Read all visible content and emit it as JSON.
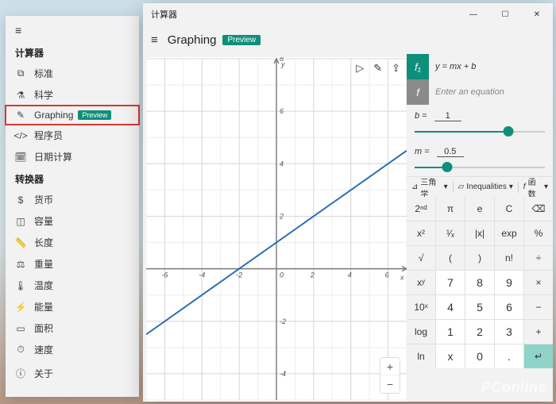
{
  "watermark": "PConline",
  "sidebar": {
    "sections": [
      {
        "header": "计算器",
        "items": [
          {
            "icon": "⧉",
            "label": "标准"
          },
          {
            "icon": "⚗",
            "label": "科学"
          },
          {
            "icon": "✎",
            "label": "Graphing",
            "badge": "Preview",
            "selected": true
          },
          {
            "icon": "</>",
            "label": "程序员"
          },
          {
            "icon": "🗓",
            "label": "日期计算"
          }
        ]
      },
      {
        "header": "转换器",
        "items": [
          {
            "icon": "$",
            "label": "货币"
          },
          {
            "icon": "◫",
            "label": "容量"
          },
          {
            "icon": "📏",
            "label": "长度"
          },
          {
            "icon": "⚖",
            "label": "重量"
          },
          {
            "icon": "🌡",
            "label": "温度"
          },
          {
            "icon": "⚡",
            "label": "能量"
          },
          {
            "icon": "▭",
            "label": "面积"
          },
          {
            "icon": "⏱",
            "label": "速度"
          }
        ]
      }
    ],
    "about": {
      "icon": "ⓘ",
      "label": "关于"
    }
  },
  "app": {
    "title": "计算器",
    "mode": "Graphing",
    "mode_badge": "Preview",
    "window": {
      "min": "—",
      "max": "☐",
      "close": "✕"
    },
    "equations": [
      {
        "fx": "f₁",
        "text": "y = mx + b",
        "active": true
      },
      {
        "fx": "f",
        "text": "Enter an equation",
        "active": false
      }
    ],
    "variables": [
      {
        "name": "b",
        "value": "1",
        "pos": 0.72
      },
      {
        "name": "m",
        "value": "0.5",
        "pos": 0.25
      }
    ],
    "fxbar": {
      "trig": "三角学",
      "ineq": "Inequalities",
      "fn": "函数"
    },
    "plot_tools": {
      "cursor": "▷",
      "trace": "✎",
      "share": "⇪"
    },
    "keypad": [
      [
        "2ⁿᵈ",
        "π",
        "e",
        "C",
        "⌫"
      ],
      [
        "x²",
        "¹⁄ₓ",
        "|x|",
        "exp",
        "%"
      ],
      [
        "√",
        "(",
        ")",
        "n!",
        "÷"
      ],
      [
        "xʸ",
        "7",
        "8",
        "9",
        "×"
      ],
      [
        "10ˣ",
        "4",
        "5",
        "6",
        "−"
      ],
      [
        "log",
        "1",
        "2",
        "3",
        "+"
      ],
      [
        "ln",
        "x",
        "0",
        ".",
        "↵"
      ]
    ],
    "keypad_num_cells": [
      "7",
      "8",
      "9",
      "4",
      "5",
      "6",
      "1",
      "2",
      "3",
      "0",
      ".",
      "x"
    ],
    "chart_data": {
      "type": "line",
      "title": "",
      "xlabel": "x",
      "ylabel": "y",
      "xlim": [
        -7,
        7
      ],
      "ylim": [
        -5,
        8
      ],
      "xticks": [
        -6,
        -4,
        -2,
        0,
        2,
        4,
        6
      ],
      "yticks": [
        -4,
        -2,
        2,
        4,
        6,
        8
      ],
      "series": [
        {
          "name": "y = 0.5x + 1",
          "color": "#2d6fb5",
          "x": [
            -7,
            -6,
            -4,
            -2,
            0,
            2,
            4,
            6,
            7
          ],
          "y": [
            -2.5,
            -2,
            -1,
            0,
            1,
            2,
            3,
            4,
            4.5
          ]
        }
      ]
    }
  }
}
